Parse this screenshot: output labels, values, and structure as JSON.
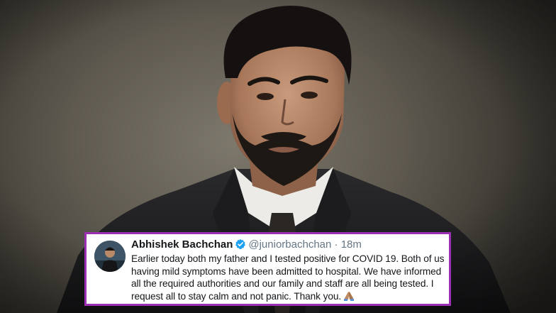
{
  "tweet": {
    "display_name": "Abhishek Bachchan",
    "handle": "@juniorbachchan",
    "separator": "·",
    "time": "18m",
    "text": "Earlier today both my father and I tested positive for COVID 19. Both of us having mild symptoms have been admitted to hospital. We have informed all the required authorities and our family and staff are all being tested. I request all to stay calm and not panic. Thank you.",
    "emoji_icon": "folded-hands-icon",
    "verified_icon": "verified-badge-icon"
  },
  "colors": {
    "card_border": "#9b2fb4",
    "verified": "#1da1f2",
    "muted_text": "#657786",
    "primary_text": "#14171a"
  }
}
